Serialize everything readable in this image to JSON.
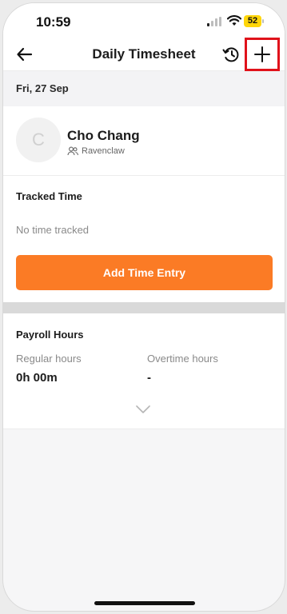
{
  "status_bar": {
    "time": "10:59",
    "battery": "52",
    "battery_color": "#ffd60a"
  },
  "header": {
    "title": "Daily Timesheet",
    "back_icon": "arrow-left-icon",
    "history_icon": "history-icon",
    "add_icon": "plus-icon",
    "highlight_color": "#e0121b"
  },
  "date": "Fri, 27 Sep",
  "user": {
    "initial": "C",
    "name": "Cho Chang",
    "group": "Ravenclaw",
    "group_icon": "people-icon"
  },
  "tracked_time": {
    "title": "Tracked Time",
    "empty_text": "No time tracked",
    "add_button_label": "Add Time Entry",
    "accent_color": "#fb7b25"
  },
  "payroll": {
    "title": "Payroll Hours",
    "regular_label": "Regular hours",
    "regular_value": "0h 00m",
    "overtime_label": "Overtime hours",
    "overtime_value": "-",
    "expand_icon": "chevron-down-icon"
  }
}
